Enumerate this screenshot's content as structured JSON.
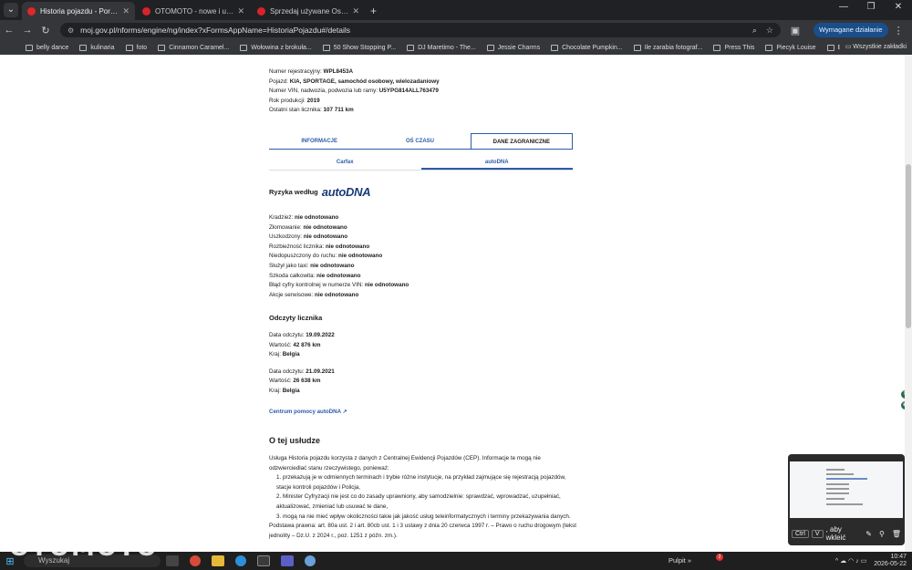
{
  "browser": {
    "tabs": [
      {
        "title": "Historia pojazdu - Portal gov.pl",
        "color": "#e2262a"
      },
      {
        "title": "OTOMOTO - nowe i używane sa",
        "color": "#d8232a"
      },
      {
        "title": "Sprzedaj używane Osobowe | O",
        "color": "#d8232a"
      }
    ],
    "new_tab": "+",
    "url": "moj.gov.pl/nforms/engine/ng/index?xFormsAppName=HistoriaPojazdu#/details",
    "action_required": "Wymagane działanie",
    "bookmarks": [
      "belly dance",
      "kulinaria",
      "foto",
      "Cinnamon Caramel...",
      "Wołowina z brokuła...",
      "50 Show Stopping P...",
      "DJ Maretimo - The...",
      "Jessie Charms",
      "Chocolate Pumpkin...",
      "Ile zarabia fotograf...",
      "Press This",
      "Piecyk Louise",
      "Black Eyes Album -..."
    ],
    "all_bookmarks": "Wszystkie zakładki"
  },
  "vehicle": {
    "reg_label": "Numer rejestracyjny:",
    "reg_value": "WPL8453A",
    "car_label": "Pojazd:",
    "car_value": "KIA, SPORTAGE, samochód osobowy, wielozadaniowy",
    "vin_label": "Numer VIN, nadwozia, podwozia lub ramy:",
    "vin_value": "U5YPG814ALL763479",
    "year_label": "Rok produkcji:",
    "year_value": "2019",
    "odo_label": "Ostatni stan licznika:",
    "odo_value": "107 711 km"
  },
  "tabs": [
    "INFORMACJE",
    "OŚ CZASU",
    "DANE ZAGRANICZNE"
  ],
  "subtabs": [
    "Carfax",
    "autoDNA"
  ],
  "risk": {
    "heading": "Ryzyka według",
    "logo": "autoDNA",
    "items": [
      {
        "label": "Kradzież:",
        "value": "nie odnotowano"
      },
      {
        "label": "Złomowanie:",
        "value": "nie odnotowano"
      },
      {
        "label": "Uszkodzony:",
        "value": "nie odnotowano"
      },
      {
        "label": "Rozbieżność licznika:",
        "value": "nie odnotowano"
      },
      {
        "label": "Niedopuszczony do ruchu:",
        "value": "nie odnotowano"
      },
      {
        "label": "Służył jako taxi:",
        "value": "nie odnotowano"
      },
      {
        "label": "Szkoda całkowita:",
        "value": "nie odnotowano"
      },
      {
        "label": "Błąd cyfry kontrolnej w numerze VIN:",
        "value": "nie odnotowano"
      },
      {
        "label": "Akcje serwisowe:",
        "value": "nie odnotowano"
      }
    ]
  },
  "odometer": {
    "heading": "Odczyty licznika",
    "readings": [
      {
        "date_label": "Data odczytu:",
        "date": "19.09.2022",
        "value_label": "Wartość:",
        "value": "42 876 km",
        "country_label": "Kraj:",
        "country": "Belgia"
      },
      {
        "date_label": "Data odczytu:",
        "date": "21.09.2021",
        "value_label": "Wartość:",
        "value": "26 638 km",
        "country_label": "Kraj:",
        "country": "Belgia"
      }
    ]
  },
  "help_link": "Centrum pomocy autoDNA",
  "about": {
    "heading": "O tej usłudze",
    "intro": "Usługa Historia pojazdu korzysta z danych z Centralnej Ewidencji Pojazdów (CEP). Informacje te mogą nie odzwierciedlać stanu rzeczywistego, ponieważ:",
    "points": [
      "1. przekazują je w odmiennych terminach i trybie różne instytucje, na przykład zajmujące się rejestracją pojazdów, stacje kontroli pojazdów i Policja,",
      "2. Minister Cyfryzacji nie jest co do zasady uprawniony, aby samodzielnie: sprawdzać, wprowadzać, uzupełniać, aktualizować, zmieniać lub usuwać te dane,",
      "3. mogą na nie mieć wpływ okoliczności takie jak jakość usług teleinformatycznych i terminy przekazywania danych."
    ],
    "legal": "Podstawa prawna: art. 80a ust. 2 i art. 80cb ust. 1 i 3 ustawy z dnia 20 czerwca 1997 r. – Prawo o ruchu drogowym (tekst jednolity – Dz.U. z 2024 r., poz. 1251 z późn. zm.)."
  },
  "preview": {
    "key1": "Ctrl",
    "key2": "V",
    "text": ", aby wkleić"
  },
  "watermark": "OTOMOTO",
  "taskbar": {
    "search": "Wyszukaj",
    "desktop": "Pulpit",
    "badge": "2",
    "time": "10:47",
    "date": "2026-05-22"
  }
}
